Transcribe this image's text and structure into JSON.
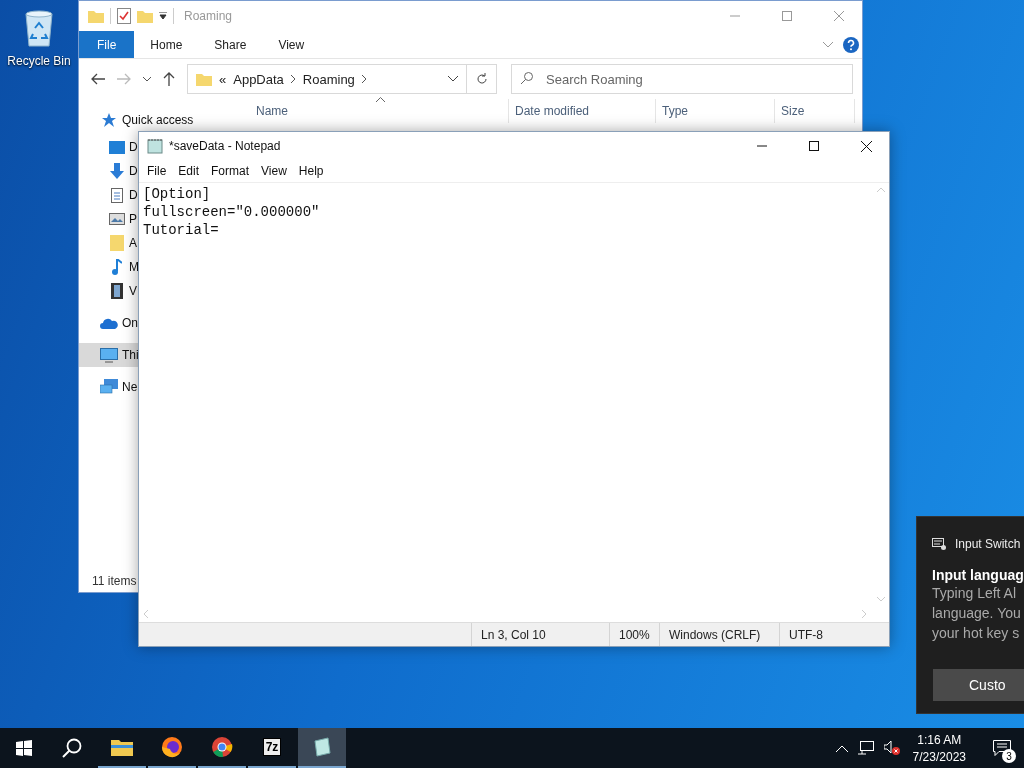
{
  "desktop": {
    "icons": [
      {
        "label": "Recycle Bin"
      }
    ]
  },
  "explorer": {
    "title": "Roaming",
    "ribbon_tabs": [
      {
        "label": "File",
        "kind": "file"
      },
      {
        "label": "Home",
        "kind": "tab"
      },
      {
        "label": "Share",
        "kind": "tab"
      },
      {
        "label": "View",
        "kind": "tab"
      }
    ],
    "address": {
      "prefix": "«",
      "crumbs": [
        "AppData",
        "Roaming"
      ]
    },
    "search": {
      "placeholder": "Search Roaming"
    },
    "columns": [
      "Name",
      "Date modified",
      "Type",
      "Size"
    ],
    "nav": [
      {
        "label": "Quick access",
        "kind": "root",
        "selected": false
      },
      {
        "label": "D",
        "kind": "pinned",
        "selected": false
      },
      {
        "label": "D",
        "kind": "pinned",
        "selected": false
      },
      {
        "label": "D",
        "kind": "pinned",
        "selected": false
      },
      {
        "label": "P",
        "kind": "pinned",
        "selected": false
      },
      {
        "label": "A",
        "kind": "pinned",
        "selected": false
      },
      {
        "label": "M",
        "kind": "pinned",
        "selected": false
      },
      {
        "label": "V",
        "kind": "pinned",
        "selected": false
      },
      {
        "label": "On",
        "kind": "root",
        "selected": false
      },
      {
        "label": "Thi",
        "kind": "root",
        "selected": true
      },
      {
        "label": "Ne",
        "kind": "root",
        "selected": false
      }
    ],
    "status": "11 items"
  },
  "notepad": {
    "title": "*saveData - Notepad",
    "menu": [
      "File",
      "Edit",
      "Format",
      "View",
      "Help"
    ],
    "lines": [
      "[Option]",
      "fullscreen=\"0.000000\"",
      "Tutorial="
    ],
    "status": [
      "Ln 3, Col 10",
      "100%",
      "Windows (CRLF)",
      "UTF-8"
    ]
  },
  "toast": {
    "app": "Input Switch",
    "heading": "Input languag",
    "lines": [
      "Typing Left Al",
      "language. You",
      "your hot key s"
    ],
    "button": "Custo"
  },
  "taskbar": {
    "apps": [
      {
        "kind": "explorer",
        "running": true,
        "active": false
      },
      {
        "kind": "firefox",
        "running": true,
        "active": false
      },
      {
        "kind": "chrome",
        "running": true,
        "active": false
      },
      {
        "kind": "archiver",
        "label": "7z",
        "running": true,
        "active": false
      },
      {
        "kind": "notepad",
        "running": true,
        "active": true
      }
    ],
    "clock": {
      "time": "1:16 AM",
      "date": "7/23/2023"
    },
    "notifications": "3"
  }
}
